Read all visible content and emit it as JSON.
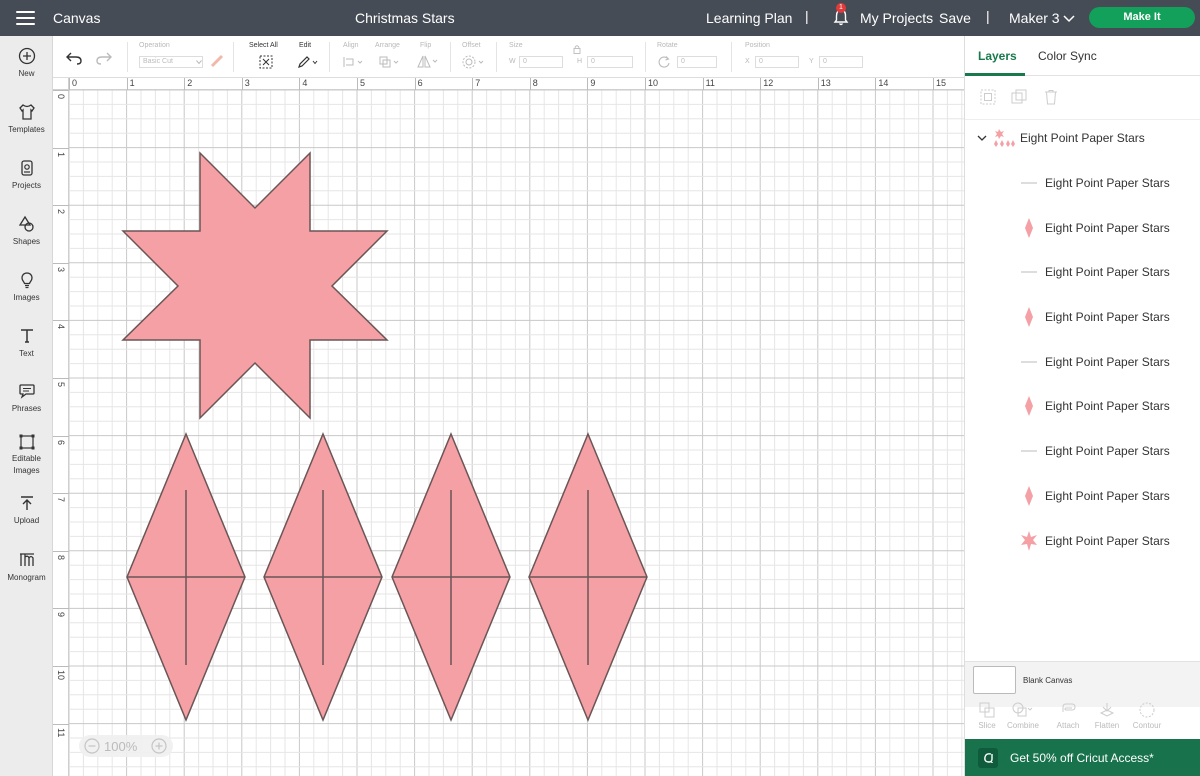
{
  "topbar": {
    "app_name": "Canvas",
    "doc_title": "Christmas Stars",
    "learning_plan": "Learning Plan",
    "notification_count": "1",
    "my_projects": "My Projects",
    "save": "Save",
    "machine": "Maker 3",
    "make_it": "Make It"
  },
  "sidebar": {
    "items": [
      {
        "label": "New",
        "icon": "plus-circle-icon"
      },
      {
        "label": "Templates",
        "icon": "shirt-icon"
      },
      {
        "label": "Projects",
        "icon": "projects-icon"
      },
      {
        "label": "Shapes",
        "icon": "shapes-icon"
      },
      {
        "label": "Images",
        "icon": "lightbulb-icon"
      },
      {
        "label": "Text",
        "icon": "text-icon"
      },
      {
        "label": "Phrases",
        "icon": "speech-bubble-icon"
      },
      {
        "label": "Editable Images",
        "icon": "editable-images-icon"
      },
      {
        "label": "Upload",
        "icon": "upload-icon"
      },
      {
        "label": "Monogram",
        "icon": "monogram-icon"
      }
    ]
  },
  "toolbar": {
    "operation_label": "Operation",
    "operation_value": "Basic Cut",
    "select_all_label": "Select All",
    "edit_label": "Edit",
    "align_label": "Align",
    "arrange_label": "Arrange",
    "flip_label": "Flip",
    "offset_label": "Offset",
    "size_label": "Size",
    "width_prefix": "W",
    "width_value": "0",
    "height_prefix": "H",
    "height_value": "0",
    "rotate_label": "Rotate",
    "rotate_value": "0",
    "position_label": "Position",
    "x_prefix": "X",
    "x_value": "0",
    "y_prefix": "Y",
    "y_value": "0"
  },
  "canvas": {
    "ruler_top": [
      "0",
      "1",
      "2",
      "3",
      "4",
      "5",
      "6",
      "7",
      "8",
      "9",
      "10",
      "11",
      "12",
      "13",
      "14",
      "15"
    ],
    "ruler_left": [
      "0",
      "1",
      "2",
      "3",
      "4",
      "5",
      "6",
      "7",
      "8",
      "9",
      "10",
      "11"
    ],
    "zoom": "100%",
    "shape_fill": "#f4a0a4",
    "shape_stroke": "#6b5556"
  },
  "panel": {
    "tabs": [
      "Layers",
      "Color Sync"
    ],
    "group_name": "Eight Point Paper Stars",
    "layers": [
      {
        "label": "Eight Point Paper Stars",
        "thumb": "line-icon"
      },
      {
        "label": "Eight Point Paper Stars",
        "thumb": "diamond-icon"
      },
      {
        "label": "Eight Point Paper Stars",
        "thumb": "line-icon"
      },
      {
        "label": "Eight Point Paper Stars",
        "thumb": "diamond-icon"
      },
      {
        "label": "Eight Point Paper Stars",
        "thumb": "line-icon"
      },
      {
        "label": "Eight Point Paper Stars",
        "thumb": "diamond-icon"
      },
      {
        "label": "Eight Point Paper Stars",
        "thumb": "line-icon"
      },
      {
        "label": "Eight Point Paper Stars",
        "thumb": "diamond-icon"
      },
      {
        "label": "Eight Point Paper Stars",
        "thumb": "star-icon"
      }
    ],
    "blank_canvas": "Blank Canvas",
    "bottom_tools": [
      "Slice",
      "Combine",
      "Attach",
      "Flatten",
      "Contour"
    ],
    "promo": "Get 50% off Cricut Access*"
  },
  "colors": {
    "topbar": "#454c55",
    "accent_green": "#12a05a",
    "tab_green": "#187a4c",
    "pink": "#f4a0a4"
  }
}
